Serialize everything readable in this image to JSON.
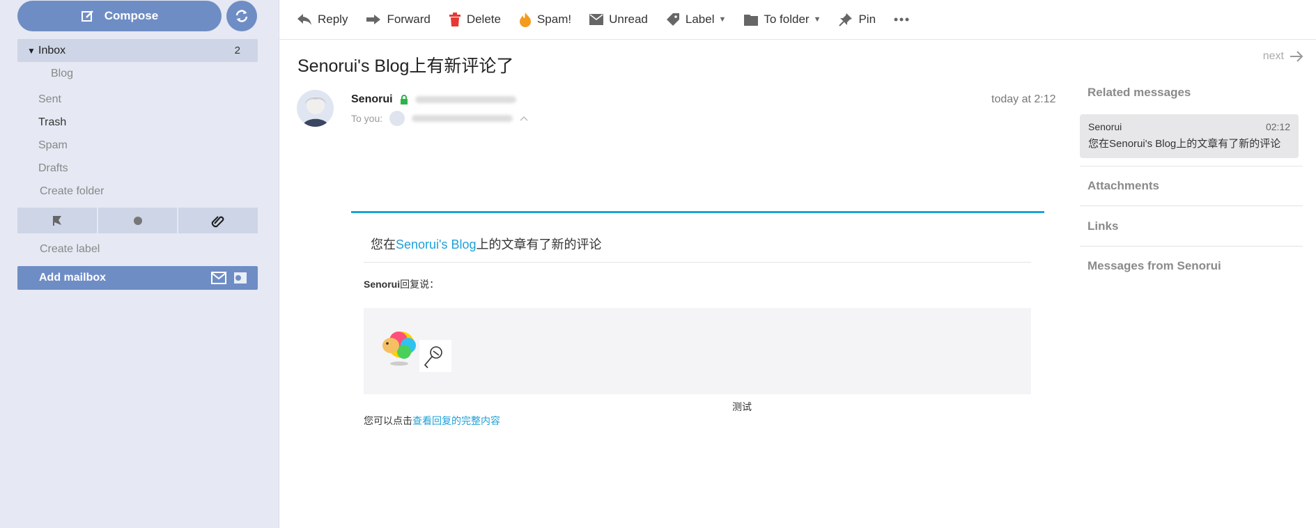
{
  "sidebar": {
    "compose_label": "Compose",
    "folders": [
      {
        "label": "Inbox",
        "count": "2"
      },
      {
        "label": "Blog"
      },
      {
        "label": "Sent"
      },
      {
        "label": "Trash"
      },
      {
        "label": "Spam"
      },
      {
        "label": "Drafts"
      },
      {
        "label": "Create folder"
      }
    ],
    "create_label": "Create label",
    "add_mailbox": "Add mailbox"
  },
  "toolbar": {
    "reply": "Reply",
    "forward": "Forward",
    "delete": "Delete",
    "spam": "Spam!",
    "unread": "Unread",
    "label": "Label",
    "to_folder": "To folder",
    "pin": "Pin"
  },
  "message": {
    "subject": "Senorui's Blog上有新评论了",
    "next": "next",
    "sender": "Senorui",
    "to_label": "To you:",
    "date": "today at 2:12",
    "body_prefix": "您在",
    "body_link": "Senorui's Blog",
    "body_suffix": "上的文章有了新的评论",
    "reply_name": "Senorui",
    "reply_suffix": "回复说：",
    "quote_text": "测试",
    "view_prefix": "您可以点击",
    "view_link": "查看回复的完整内容"
  },
  "panel": {
    "related_title": "Related messages",
    "related_sender": "Senorui",
    "related_time": "02:12",
    "related_snippet": "您在Senorui's Blog上的文章有了新的评论",
    "attachments": "Attachments",
    "links": "Links",
    "messages_from": "Messages from Senorui"
  },
  "colors": {
    "accent": "#6f8dc5",
    "link": "#1ea1d8",
    "sidebar_bg": "#e6e9f3"
  }
}
